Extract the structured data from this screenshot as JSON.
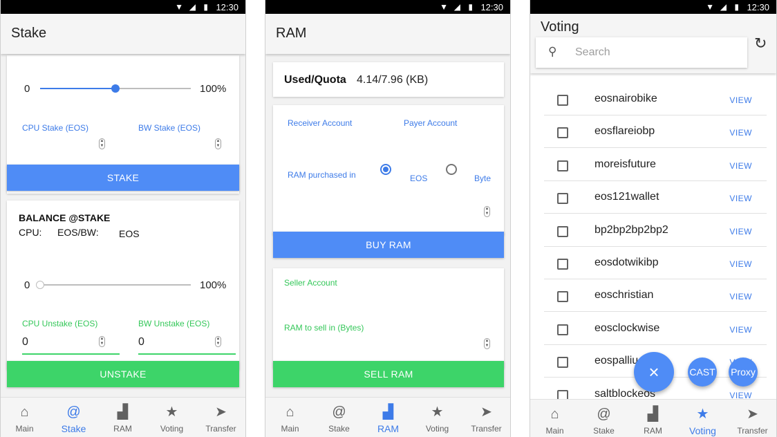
{
  "status": {
    "time": "12:30"
  },
  "nav": [
    {
      "label": "Main",
      "icon": "home-icon"
    },
    {
      "label": "Stake",
      "icon": "at-icon"
    },
    {
      "label": "RAM",
      "icon": "bar-chart-icon"
    },
    {
      "label": "Voting",
      "icon": "star-icon"
    },
    {
      "label": "Transfer",
      "icon": "send-icon"
    }
  ],
  "stake": {
    "title": "Stake",
    "slider_min": "0",
    "slider_max": "100%",
    "stake_slider_value": 0.5,
    "cpu_stake_label": "CPU Stake (EOS)",
    "bw_stake_label": "BW Stake (EOS)",
    "stake_button": "STAKE",
    "balance_title": "BALANCE @STAKE",
    "cpu_label": "CPU:",
    "eos_bw_label": "EOS/BW:",
    "eos_unit": "EOS",
    "unstake_slider_min": "0",
    "unstake_slider_max": "100%",
    "unstake_slider_value": 0,
    "cpu_unstake_label": "CPU Unstake (EOS)",
    "bw_unstake_label": "BW Unstake (EOS)",
    "cpu_unstake_value": "0",
    "bw_unstake_value": "0",
    "unstake_button": "UNSTAKE"
  },
  "ram": {
    "title": "RAM",
    "quota_label": "Used/Quota",
    "quota_value": "4.14/7.96 (KB)",
    "receiver_label": "Receiver Account",
    "payer_label": "Payer Account",
    "purchased_in_label": "RAM purchased in",
    "option_eos": "EOS",
    "option_byte": "Byte",
    "selected_option": "EOS",
    "buy_button": "BUY RAM",
    "seller_label": "Seller Account",
    "sell_bytes_label": "RAM to sell in (Bytes)",
    "sell_button": "SELL RAM"
  },
  "voting": {
    "title": "Voting",
    "search_placeholder": "Search",
    "view_label": "VIEW",
    "producers": [
      "eosnairobike",
      "eosflareiobp",
      "moreisfuture",
      "eos121wallet",
      "bp2bp2bp2bp2",
      "eosdotwikibp",
      "eoschristian",
      "eosclockwise",
      "eospalliu",
      "saltblockeos"
    ],
    "fab_close": "×",
    "fab_cast": "CAST",
    "fab_proxy": "Proxy"
  }
}
